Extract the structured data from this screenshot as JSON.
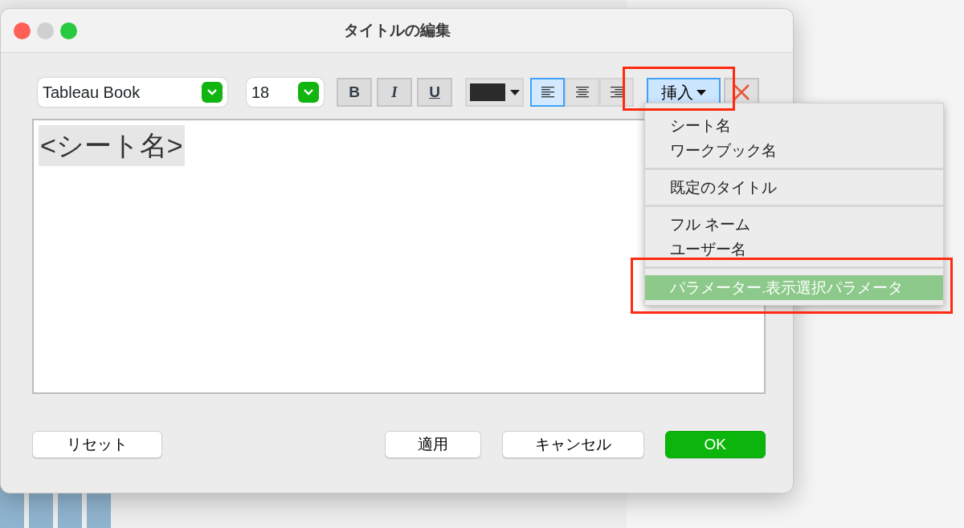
{
  "window": {
    "title": "タイトルの編集"
  },
  "toolbar": {
    "font": {
      "value": "Tableau Book"
    },
    "size": {
      "value": "18"
    },
    "styles": [
      {
        "label": "B",
        "kind": "bold",
        "on": false
      },
      {
        "label": "I",
        "kind": "italic",
        "on": false
      },
      {
        "label": "U",
        "kind": "underline",
        "on": false
      }
    ],
    "alignments": [
      {
        "kind": "left",
        "selected": true
      },
      {
        "kind": "center",
        "selected": false
      },
      {
        "kind": "right",
        "selected": false
      }
    ],
    "insert_button": {
      "label": "挿入",
      "expanded": true,
      "highlighted": true
    }
  },
  "editor": {
    "text": "<シート名>",
    "selected": true
  },
  "insert_menu": [
    {
      "items": [
        {
          "label": "シート名",
          "selected": false,
          "highlighted": false
        },
        {
          "label": "ワークブック名",
          "selected": false,
          "highlighted": false
        }
      ]
    },
    {
      "items": [
        {
          "label": "既定のタイトル",
          "selected": false,
          "highlighted": false
        }
      ]
    },
    {
      "items": [
        {
          "label": "フル ネーム",
          "selected": false,
          "highlighted": false
        },
        {
          "label": "ユーザー名",
          "selected": false,
          "highlighted": false
        }
      ]
    },
    {
      "items": [
        {
          "label": "パラメーター.表示選択パラメータ",
          "selected": true,
          "highlighted": true
        }
      ]
    }
  ],
  "buttons": [
    {
      "label": "リセット",
      "kind": "normal"
    },
    {
      "label": "適用",
      "kind": "normal"
    },
    {
      "label": "キャンセル",
      "kind": "normal"
    },
    {
      "label": "OK",
      "kind": "primary"
    }
  ]
}
